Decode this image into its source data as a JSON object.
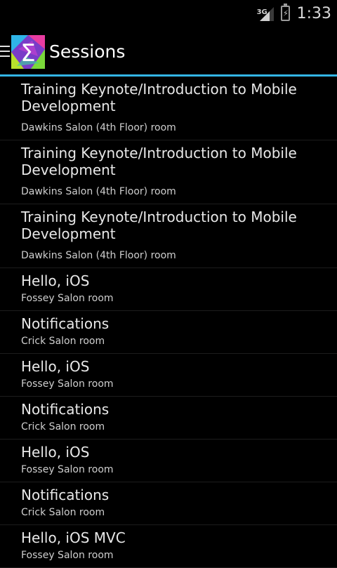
{
  "status_bar": {
    "network_label": "3G",
    "time": "1:33",
    "icons": [
      "signal-icon",
      "battery-charging-icon"
    ]
  },
  "action_bar": {
    "title": "Sessions",
    "icons": [
      "drawer-indicator-icon",
      "app-logo-icon"
    ],
    "accent_color": "#33b5e5"
  },
  "sessions": [
    {
      "title": "Training Keynote/Introduction to Mobile Development",
      "room": "Dawkins Salon (4th Floor) room"
    },
    {
      "title": "Training Keynote/Introduction to Mobile Development",
      "room": "Dawkins Salon (4th Floor) room"
    },
    {
      "title": "Training Keynote/Introduction to Mobile Development",
      "room": "Dawkins Salon (4th Floor) room"
    },
    {
      "title": "Hello, iOS",
      "room": "Fossey Salon room"
    },
    {
      "title": "Notifications",
      "room": "Crick Salon room"
    },
    {
      "title": "Hello, iOS",
      "room": "Fossey Salon room"
    },
    {
      "title": "Notifications",
      "room": "Crick Salon room"
    },
    {
      "title": "Hello, iOS",
      "room": "Fossey Salon room"
    },
    {
      "title": "Notifications",
      "room": "Crick Salon room"
    },
    {
      "title": "Hello, iOS MVC",
      "room": "Fossey Salon room"
    }
  ]
}
